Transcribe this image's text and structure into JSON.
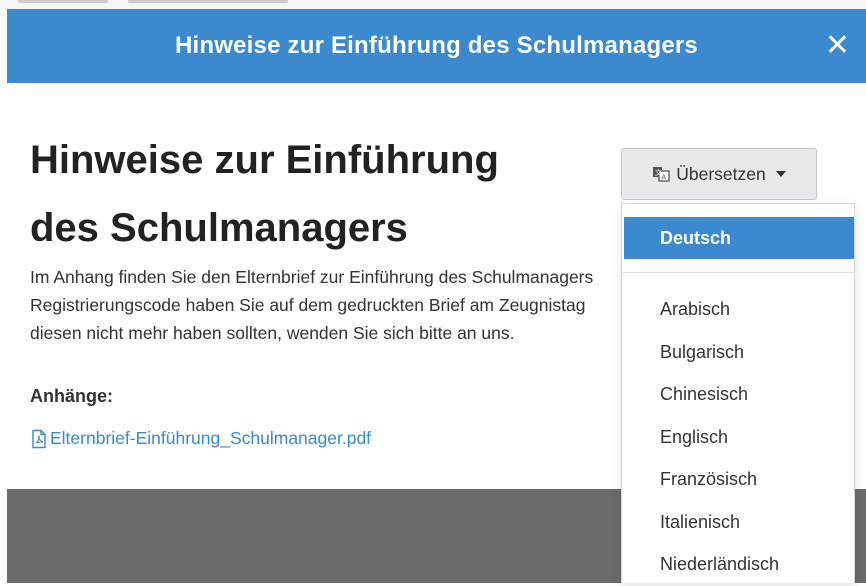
{
  "header": {
    "title": "Hinweise zur Einführung des Schulmanagers",
    "close_glyph": "✕"
  },
  "content": {
    "heading_line1": "Hinweise zur Einführung",
    "heading_line2": "des Schulmanagers",
    "paragraph_lines": [
      "Im Anhang finden Sie den Elternbrief zur Einführung des Schulmanagers",
      "Registrierungscode haben Sie auf dem gedruckten Brief am Zeugnistag",
      "diesen nicht mehr haben sollten, wenden Sie sich bitte an uns."
    ],
    "attachments_label": "Anhänge:",
    "attachment_file": "Elternbrief-Einführung_Schulmanager.pdf"
  },
  "translate": {
    "button_label": "Übersetzen",
    "active_language": "Deutsch",
    "languages": [
      "Arabisch",
      "Bulgarisch",
      "Chinesisch",
      "Englisch",
      "Französisch",
      "Italienisch",
      "Niederländisch"
    ]
  },
  "colors": {
    "primary": "#3b89cf",
    "footer": "#6b6b6b"
  },
  "icons": {
    "translate": "translate-icon",
    "pdf": "pdf-file-icon",
    "close": "close-icon"
  }
}
